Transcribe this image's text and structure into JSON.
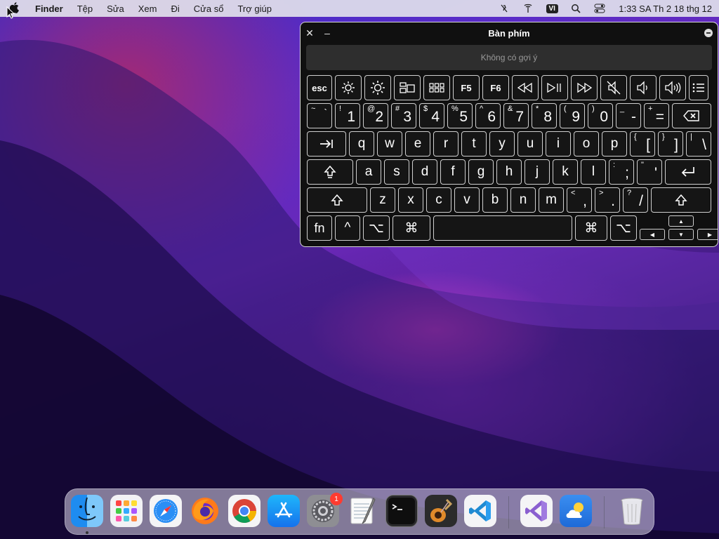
{
  "menubar": {
    "apple": "",
    "items": [
      "Finder",
      "Tệp",
      "Sửa",
      "Xem",
      "Đi",
      "Cửa sổ",
      "Trợ giúp"
    ],
    "input_source": "VI",
    "clock": "1:33 SA Th 2 18 thg 12",
    "status_icons": [
      "slash-icon",
      "antenna-icon",
      "search-icon",
      "control-center-icon"
    ]
  },
  "keyboard": {
    "title": "Bàn phím",
    "suggestion": "Không có gợi ý",
    "fkeys": [
      "esc",
      "brightness-down",
      "brightness-up",
      "mission-control",
      "launchpad",
      "F5",
      "F6",
      "rewind",
      "play-pause",
      "fast-forward",
      "mute",
      "volume-down",
      "volume-up",
      "list"
    ],
    "number_row": [
      {
        "sec": "~",
        "pri": "`"
      },
      {
        "sec": "!",
        "pri": "1"
      },
      {
        "sec": "@",
        "pri": "2"
      },
      {
        "sec": "#",
        "pri": "3"
      },
      {
        "sec": "$",
        "pri": "4"
      },
      {
        "sec": "%",
        "pri": "5"
      },
      {
        "sec": "^",
        "pri": "6"
      },
      {
        "sec": "&",
        "pri": "7"
      },
      {
        "sec": "*",
        "pri": "8"
      },
      {
        "sec": "(",
        "pri": "9"
      },
      {
        "sec": ")",
        "pri": "0"
      },
      {
        "sec": "_",
        "pri": "-"
      },
      {
        "sec": "+",
        "pri": "="
      }
    ],
    "qwerty_row": [
      "q",
      "w",
      "e",
      "r",
      "t",
      "y",
      "u",
      "i",
      "o",
      "p"
    ],
    "qwerty_extra": [
      {
        "sec": "{",
        "pri": "["
      },
      {
        "sec": "}",
        "pri": "]"
      },
      {
        "sec": "|",
        "pri": "\\"
      }
    ],
    "home_row": [
      "a",
      "s",
      "d",
      "f",
      "g",
      "h",
      "j",
      "k",
      "l"
    ],
    "home_extra": [
      {
        "sec": ":",
        "pri": ";"
      },
      {
        "sec": "\"",
        "pri": "'"
      }
    ],
    "bottom_row": [
      "z",
      "x",
      "c",
      "v",
      "b",
      "n",
      "m"
    ],
    "bottom_extra": [
      {
        "sec": "<",
        "pri": ","
      },
      {
        "sec": ">",
        "pri": "."
      },
      {
        "sec": "?",
        "pri": "/"
      }
    ],
    "mod_fn": "fn",
    "mod_control": "^",
    "mod_option": "⌥",
    "mod_command": "⌘"
  },
  "dock": {
    "apps": [
      "finder-icon",
      "launchpad-icon",
      "safari-icon",
      "firefox-icon",
      "chrome-icon",
      "app-store-icon",
      "system-settings-icon",
      "textedit-icon",
      "terminal-icon",
      "garageband-icon",
      "vscode-icon",
      "visual-studio-icon",
      "weather-icon",
      "trash-icon"
    ],
    "settings_badge": "1"
  }
}
